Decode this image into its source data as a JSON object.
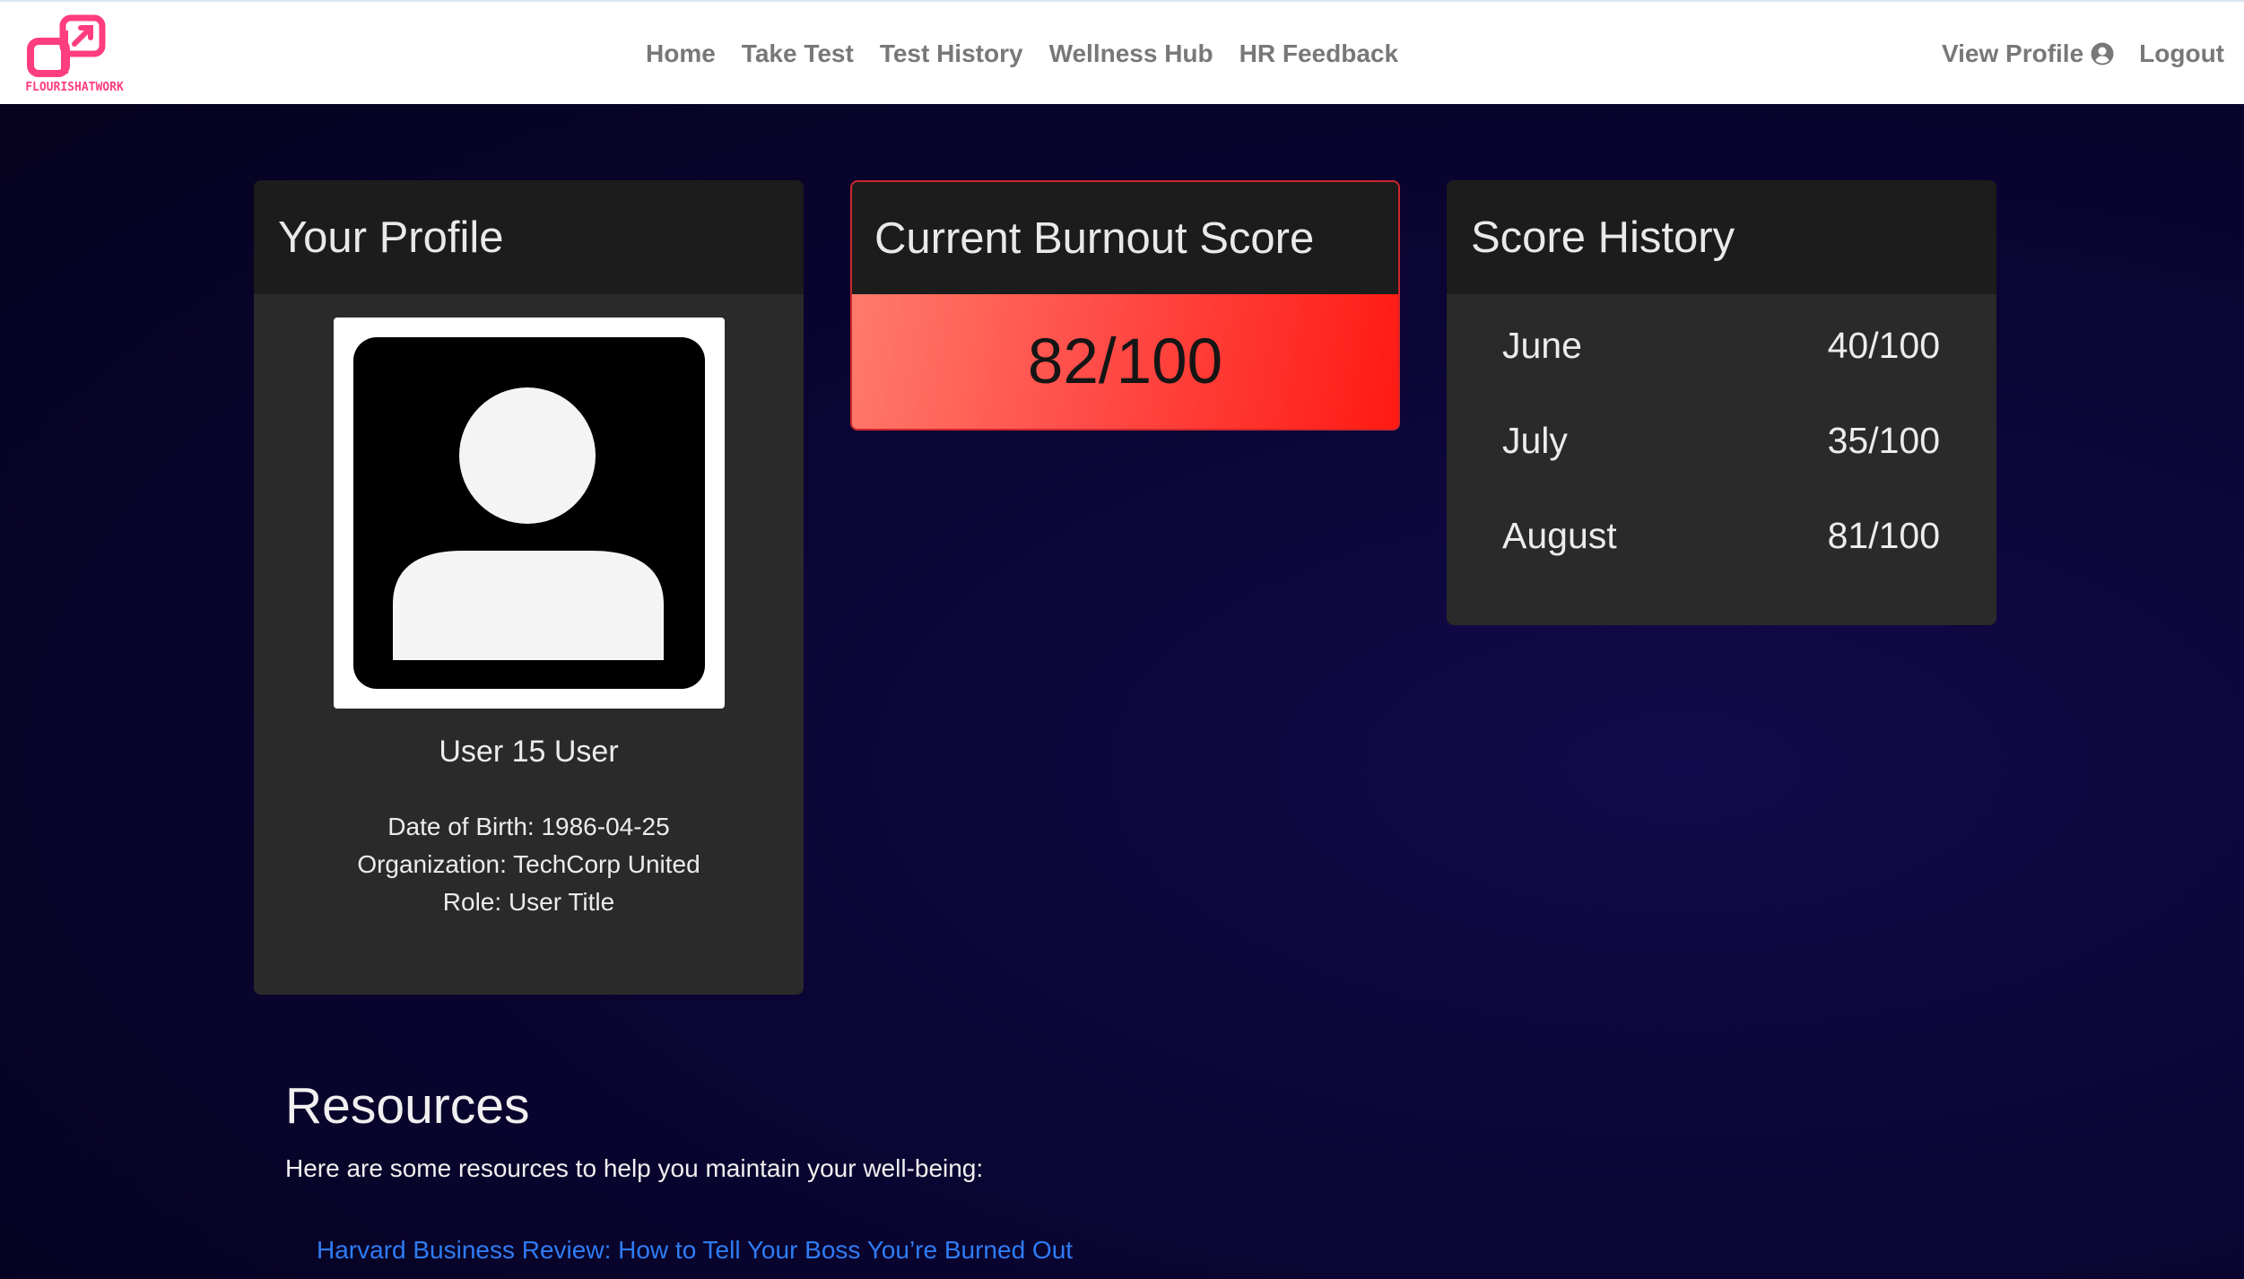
{
  "brand": {
    "logo_text": "FLOURISHATWORK",
    "accent_color": "#ff3d7f"
  },
  "nav": {
    "links": [
      "Home",
      "Take Test",
      "Test History",
      "Wellness Hub",
      "HR Feedback"
    ],
    "view_profile": "View Profile",
    "logout": "Logout"
  },
  "profile": {
    "title": "Your Profile",
    "name": "User 15 User",
    "dob": "Date of Birth: 1986-04-25",
    "organization": "Organization: TechCorp United",
    "role": "Role: User Title"
  },
  "burnout": {
    "title": "Current Burnout Score",
    "score": "82/100",
    "accent_color": "#ff2b22"
  },
  "history": {
    "title": "Score History",
    "rows": [
      {
        "month": "June",
        "score": "40/100"
      },
      {
        "month": "July",
        "score": "35/100"
      },
      {
        "month": "August",
        "score": "81/100"
      }
    ]
  },
  "resources": {
    "title": "Resources",
    "intro": "Here are some resources to help you maintain your well-being:",
    "links": [
      "Harvard Business Review: How to Tell Your Boss You’re Burned Out"
    ]
  },
  "icons": {
    "logo": "flourish-logo-icon",
    "user": "user-circle-icon",
    "avatar": "avatar-placeholder-icon"
  }
}
